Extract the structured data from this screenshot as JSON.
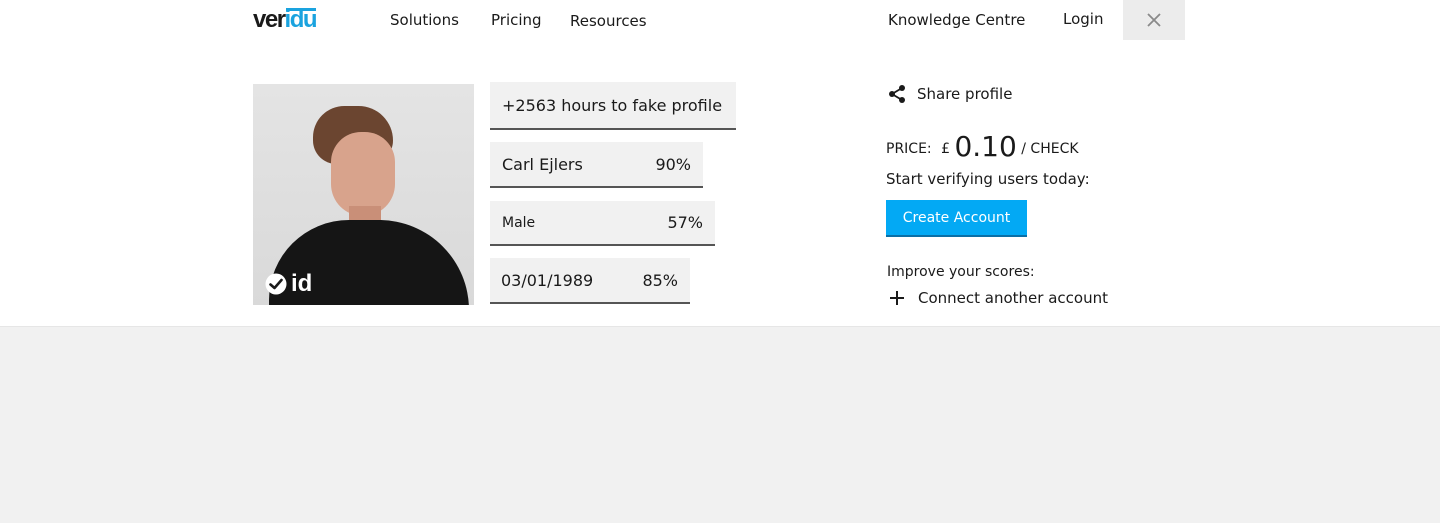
{
  "header": {
    "logo": {
      "part1": "ver",
      "part2": "idu"
    },
    "nav": [
      "Solutions",
      "Pricing",
      "Resources"
    ],
    "knowledge_centre": "Knowledge Centre",
    "login": "Login",
    "close_icon": "close-icon"
  },
  "profile": {
    "photo_icon": "portrait",
    "badge_text": "id",
    "hours_text": "+2563 hours to fake profile",
    "fields": [
      {
        "label": "Carl Ejlers",
        "score": "90%"
      },
      {
        "label": "Male",
        "score": "57%"
      },
      {
        "label": "03/01/1989",
        "score": "85%"
      }
    ]
  },
  "sidebar": {
    "share": "Share profile",
    "price_label": "PRICE:",
    "currency": "£",
    "price_value": "0.10",
    "per_check": "/ CHECK",
    "subtitle": "Start verifying users today:",
    "cta": "Create Account",
    "improve": "Improve your scores:",
    "connect": "Connect another account"
  },
  "colors": {
    "accent": "#03a9f4",
    "logo_blue": "#1aa3df",
    "field_bg": "#f1f1f1"
  }
}
